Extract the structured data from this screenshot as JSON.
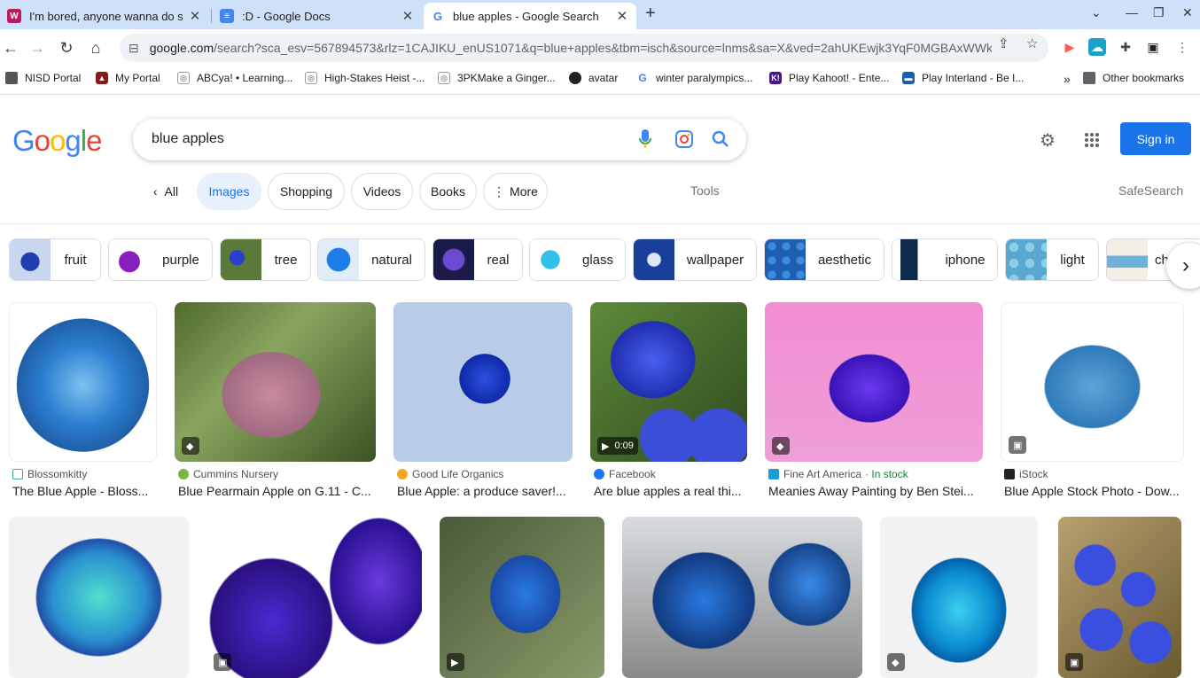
{
  "browser": {
    "tabs": [
      {
        "title": "I'm bored, anyone wanna do stu",
        "favicon": "w-icon",
        "color": "#c2185b"
      },
      {
        "title": ":D - Google Docs",
        "favicon": "docs-icon",
        "color": "#4285f4"
      },
      {
        "title": "blue apples - Google Search",
        "favicon": "google-icon",
        "color": "#ffffff"
      }
    ],
    "url_host": "google.com",
    "url_rest": "/search?sca_esv=567894573&rlz=1CAJIKU_enUS1071&q=blue+apples&tbm=isch&source=lnms&sa=X&ved=2ahUKEwjk3YqF0MGBAxWWk...",
    "bookmarks": [
      {
        "label": "NISD Portal"
      },
      {
        "label": "My Portal"
      },
      {
        "label": "ABCya! • Learning..."
      },
      {
        "label": "High-Stakes Heist -..."
      },
      {
        "label": "3PKMake a Ginger..."
      },
      {
        "label": "avatar"
      },
      {
        "label": "winter paralympics..."
      },
      {
        "label": "Play Kahoot! - Ente..."
      },
      {
        "label": "Play Interland - Be I..."
      }
    ],
    "other_bookmarks": "Other bookmarks",
    "overflow": "»"
  },
  "google": {
    "logo": "Google",
    "query": "blue apples",
    "sign_in": "Sign in",
    "all_label": "All",
    "filters": [
      "Images",
      "Shopping",
      "Videos",
      "Books"
    ],
    "more_label": "More",
    "tools_label": "Tools",
    "safesearch_label": "SafeSearch",
    "related": [
      "fruit",
      "purple",
      "tree",
      "natural",
      "real",
      "glass",
      "wallpaper",
      "aesthetic",
      "iphone",
      "light",
      "ch"
    ]
  },
  "results_row1": [
    {
      "source": "Blossomkitty",
      "title": "The Blue Apple - Bloss..."
    },
    {
      "source": "Cummins Nursery",
      "title": "Blue Pearmain Apple on G.11 - C..."
    },
    {
      "source": "Good Life Organics",
      "title": "Blue Apple: a produce saver!..."
    },
    {
      "source": "Facebook",
      "title": "Are blue apples a real thi...",
      "duration": "0:09"
    },
    {
      "source": "Fine Art America",
      "stock": "· In stock",
      "title": "Meanies Away Painting by Ben Stei..."
    },
    {
      "source": "iStock",
      "title": "Blue Apple Stock Photo - Dow..."
    }
  ]
}
